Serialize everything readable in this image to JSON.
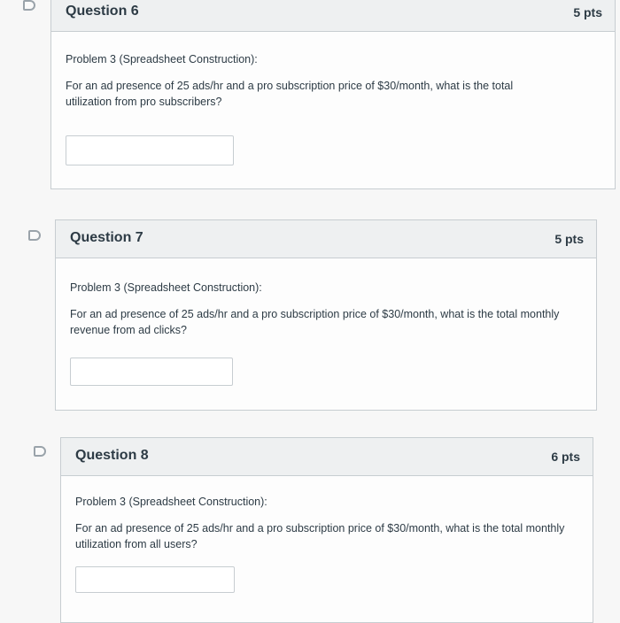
{
  "questions": [
    {
      "title": "Question 6",
      "points": "5 pts",
      "problem": "Problem 3 (Spreadsheet Construction):",
      "text": "For an ad presence of 25 ads/hr and a pro subscription price of $30/month, what is the total utilization from pro subscribers?",
      "answer": ""
    },
    {
      "title": "Question 7",
      "points": "5 pts",
      "problem": "Problem 3 (Spreadsheet Construction):",
      "text": "For an ad presence of 25 ads/hr and a pro subscription price of $30/month, what is the total monthly revenue from ad clicks?",
      "answer": ""
    },
    {
      "title": "Question 8",
      "points": "6 pts",
      "problem": "Problem 3 (Spreadsheet Construction):",
      "text": "For an ad presence of 25 ads/hr and a pro subscription price of $30/month, what is the total monthly utilization from all users?",
      "answer": ""
    }
  ]
}
